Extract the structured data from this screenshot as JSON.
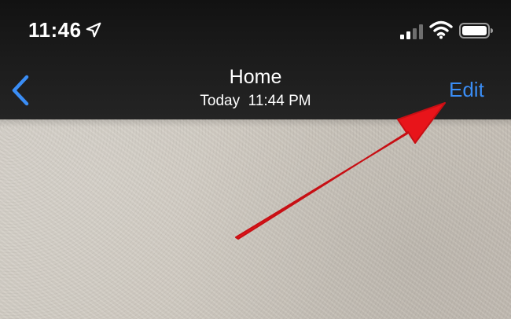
{
  "status_bar": {
    "time": "11:46",
    "icons": [
      "location-arrow-icon",
      "cellular-signal-icon",
      "wifi-icon",
      "battery-icon"
    ]
  },
  "nav_bar": {
    "back_icon": "chevron-left-icon",
    "title": "Home",
    "subtitle": "Today  11:44 PM",
    "edit_label": "Edit"
  },
  "colors": {
    "nav_background": "#1b1b1b",
    "accent": "#3a8df5",
    "arrow": "#e8141a",
    "photo_wall": "#cfc9c0"
  }
}
